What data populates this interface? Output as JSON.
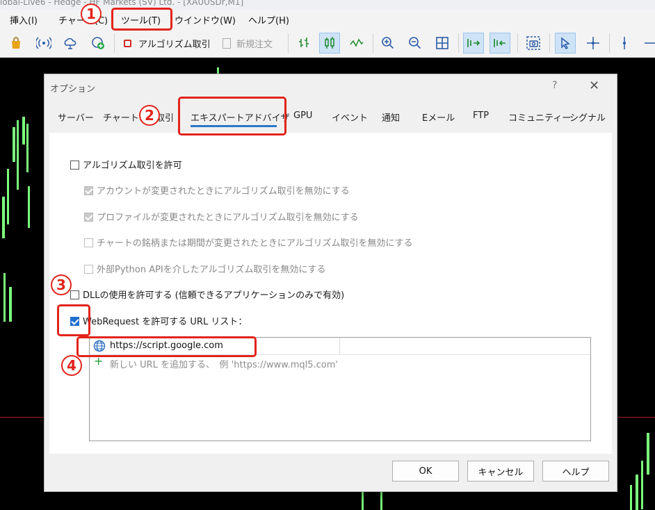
{
  "window": {
    "title": "lobal-Live6 - Hedge - HF Markets (SV) Ltd. - [XAUUSDr,M1]"
  },
  "menu": {
    "items": [
      "挿入(I)",
      "チャート(C)",
      "ツール(T)",
      "ウインドウ(W)",
      "ヘルプ(H)"
    ]
  },
  "toolbar": {
    "algo_label": "アルゴリズム取引",
    "new_order_label": "新規注文"
  },
  "dialog": {
    "title": "オプション",
    "help_glyph": "?",
    "close_glyph": "✕",
    "tabs": [
      "サーバー",
      "チャート",
      "取引",
      "エキスパートアドバイザ",
      "GPU",
      "イベント",
      "通知",
      "Eメール",
      "FTP",
      "コミュニティー",
      "シグナル"
    ],
    "selected_tab": "エキスパートアドバイザ",
    "options": {
      "allow_algo": "アルゴリズム取引を許可",
      "disable_on_account": "アカウントが変更されたときにアルゴリズム取引を無効にする",
      "disable_on_profile": "プロファイルが変更されたときにアルゴリズム取引を無効にする",
      "disable_on_chart": "チャートの銘柄または期間が変更されたときにアルゴリズム取引を無効にする",
      "disable_python": "外部Python APIを介したアルゴリズム取引を無効にする",
      "allow_dll": "DLLの使用を許可する (信頼できるアプリケーションのみで有効)",
      "allow_webrequest": "WebRequest を許可する URL リスト："
    },
    "url_list": {
      "urls": [
        "https://script.google.com"
      ],
      "add_hint": "新しい URL を追加する、　例 'https://www.mql5.com'"
    },
    "buttons": {
      "ok": "OK",
      "cancel": "キャンセル",
      "help": "ヘルプ"
    }
  },
  "annotations": {
    "step1": "1",
    "step2": "2",
    "step3": "3",
    "step4": "4"
  },
  "colors": {
    "annotation_red": "#e2231a",
    "accent_blue": "#2a78c8",
    "candle_green": "#7cff7c"
  }
}
